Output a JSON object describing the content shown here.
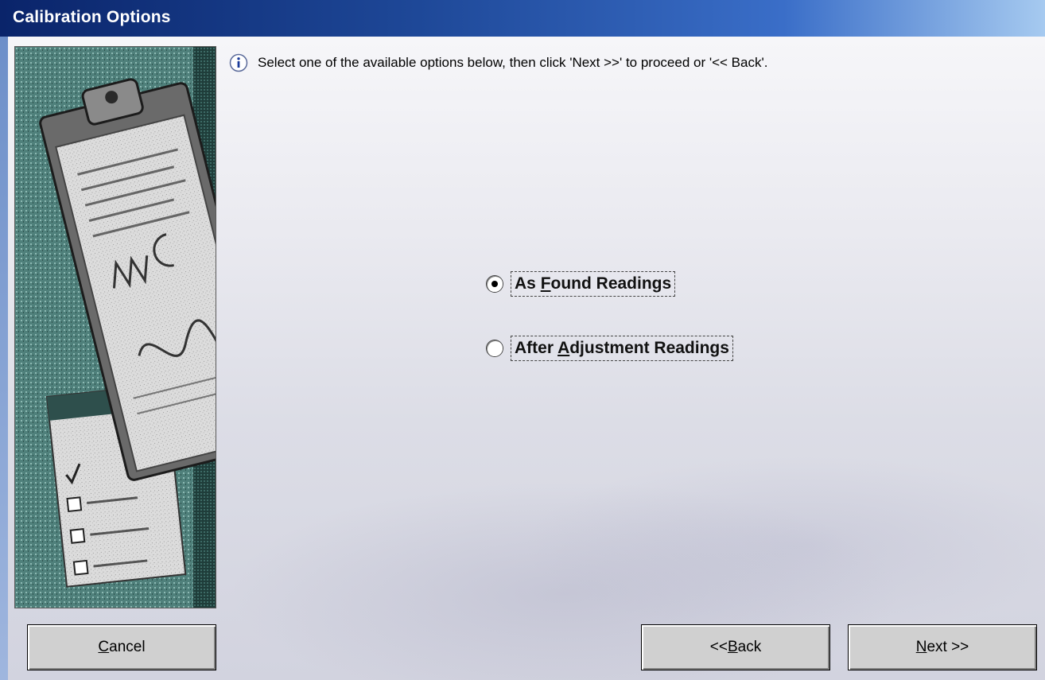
{
  "window": {
    "title": "Calibration Options"
  },
  "info": {
    "icon": "info-icon",
    "text": "Select one of the available options below, then click 'Next >>' to proceed or '<< Back'."
  },
  "options": [
    {
      "label_pre": "As ",
      "mnemonic": "F",
      "label_post": "ound Readings",
      "selected": true
    },
    {
      "label_pre": "After ",
      "mnemonic": "A",
      "label_post": "djustment Readings",
      "selected": false
    }
  ],
  "buttons": {
    "cancel": {
      "mnemonic": "C",
      "rest": "ancel"
    },
    "back": {
      "pre": "<< ",
      "mnemonic": "B",
      "rest": "ack"
    },
    "next": {
      "mnemonic": "N",
      "rest": "ext >>"
    }
  },
  "colors": {
    "title_bar_start": "#0a246a",
    "title_bar_end": "#a6caf0",
    "button_face": "#d0d0d0"
  }
}
